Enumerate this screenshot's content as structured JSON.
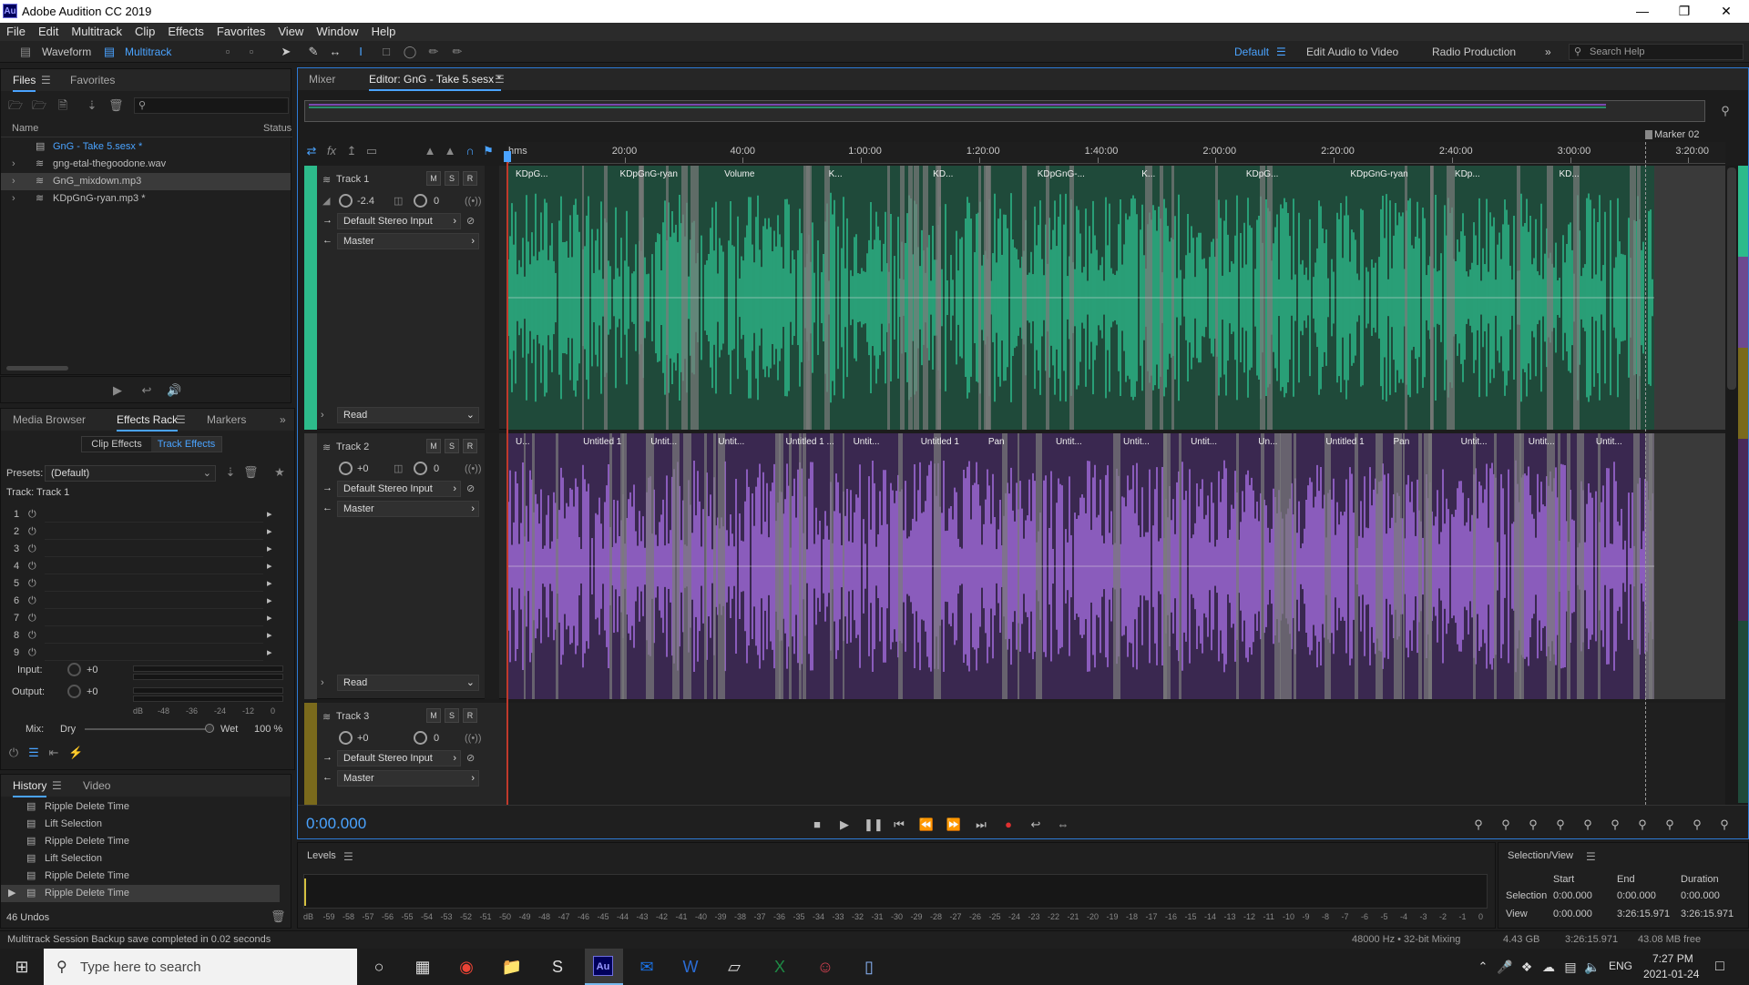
{
  "window": {
    "title": "Adobe Audition CC 2019",
    "app_icon": "Au"
  },
  "menu": [
    "File",
    "Edit",
    "Multitrack",
    "Clip",
    "Effects",
    "Favorites",
    "View",
    "Window",
    "Help"
  ],
  "toolbar": {
    "waveform_label": "Waveform",
    "multitrack_label": "Multitrack",
    "workspaces": [
      "Default",
      "Edit Audio to Video",
      "Radio Production"
    ],
    "search_placeholder": "Search Help"
  },
  "files_panel": {
    "tabs": [
      "Files",
      "Favorites"
    ],
    "col_name": "Name",
    "col_status": "Status",
    "items": [
      {
        "name": "GnG - Take 5.sesx *",
        "active": true
      },
      {
        "name": "gng-etal-thegoodone.wav"
      },
      {
        "name": "GnG_mixdown.mp3",
        "selected": true
      },
      {
        "name": "KDpGnG-ryan.mp3 *"
      }
    ]
  },
  "effects_panel": {
    "tabs": [
      "Media Browser",
      "Effects Rack",
      "Markers"
    ],
    "subtabs": [
      "Clip Effects",
      "Track Effects"
    ],
    "presets_label": "Presets:",
    "presets_value": "(Default)",
    "track_label": "Track: Track 1",
    "slots": [
      "1",
      "2",
      "3",
      "4",
      "5",
      "6",
      "7",
      "8",
      "9"
    ],
    "input_label": "Input:",
    "input_value": "+0",
    "output_label": "Output:",
    "output_value": "+0",
    "meter_ticks": [
      "dB",
      "-48",
      "-36",
      "-24",
      "-12",
      "0"
    ],
    "mix_label": "Mix:",
    "dry_label": "Dry",
    "wet_label": "Wet",
    "wet_value": "100 %"
  },
  "history_panel": {
    "tabs": [
      "History",
      "Video"
    ],
    "items": [
      "Ripple Delete Time",
      "Lift Selection",
      "Ripple Delete Time",
      "Lift Selection",
      "Ripple Delete Time",
      "Ripple Delete Time"
    ],
    "undos": "46 Undos"
  },
  "status_message": "Multitrack Session Backup save completed in 0.02 seconds",
  "editor": {
    "tabs": [
      "Mixer",
      "Editor: GnG - Take 5.sesx *"
    ],
    "ruler": [
      "hms",
      "20:00",
      "40:00",
      "1:00:00",
      "1:20:00",
      "1:40:00",
      "2:00:00",
      "2:20:00",
      "2:40:00",
      "3:00:00",
      "3:20:00"
    ],
    "marker": "Marker 02",
    "tracks": [
      {
        "name": "Track 1",
        "volume": "-2.4",
        "pan": "0",
        "input": "Default Stereo Input",
        "output": "Master",
        "automation": "Read",
        "color": "#2dbb8b",
        "clips": [
          "KDpG...",
          "KDpGnG-ryan",
          "Volume",
          "K...",
          "KD...",
          "KDpGnG-...",
          "K...",
          "KDpG...",
          "KDpGnG-ryan",
          "KDp...",
          "KD..."
        ]
      },
      {
        "name": "Track 2",
        "volume": "+0",
        "pan": "0",
        "input": "Default Stereo Input",
        "output": "Master",
        "automation": "Read",
        "color": "#a56de0",
        "clips": [
          "U...",
          "Untitled 1",
          "Untit...",
          "Untit...",
          "Untitled 1 ...",
          "Untit...",
          "Untitled 1",
          "Pan",
          "Untit...",
          "Untit...",
          "Untit...",
          "Un...",
          "Untitled 1",
          "Pan",
          "Untit...",
          "Untit...",
          "Untit..."
        ]
      },
      {
        "name": "Track 3",
        "volume": "+0",
        "pan": "0",
        "input": "Default Stereo Input",
        "output": "Master",
        "color": "#7a6a1c"
      }
    ],
    "buttons": {
      "m": "M",
      "s": "S",
      "r": "R"
    },
    "time": "0:00.000"
  },
  "levels": {
    "title": "Levels",
    "scale": [
      "dB",
      "-59",
      "-58",
      "-57",
      "-56",
      "-55",
      "-54",
      "-53",
      "-52",
      "-51",
      "-50",
      "-49",
      "-48",
      "-47",
      "-46",
      "-45",
      "-44",
      "-43",
      "-42",
      "-41",
      "-40",
      "-39",
      "-38",
      "-37",
      "-36",
      "-35",
      "-34",
      "-33",
      "-32",
      "-31",
      "-30",
      "-29",
      "-28",
      "-27",
      "-26",
      "-25",
      "-24",
      "-23",
      "-22",
      "-21",
      "-20",
      "-19",
      "-18",
      "-17",
      "-16",
      "-15",
      "-14",
      "-13",
      "-12",
      "-11",
      "-10",
      "-9",
      "-8",
      "-7",
      "-6",
      "-5",
      "-4",
      "-3",
      "-2",
      "-1",
      "0"
    ]
  },
  "selection_view": {
    "title": "Selection/View",
    "headers": [
      "Start",
      "End",
      "Duration"
    ],
    "selection_label": "Selection",
    "selection": [
      "0:00.000",
      "0:00.000",
      "0:00.000"
    ],
    "view_label": "View",
    "view": [
      "0:00.000",
      "3:26:15.971",
      "3:26:15.971"
    ]
  },
  "statusbar": {
    "sample": "48000 Hz • 32-bit Mixing",
    "size": "4.43 GB",
    "duration": "3:26:15.971",
    "free": "43.08 MB free"
  },
  "taskbar": {
    "search_placeholder": "Type here to search",
    "lang": "ENG",
    "time": "7:27 PM",
    "date": "2021-01-24"
  }
}
